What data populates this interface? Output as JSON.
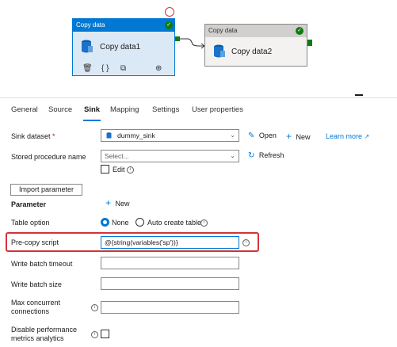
{
  "pipeline": {
    "activity1": {
      "header": "Copy data",
      "name": "Copy data1",
      "status": "succeeded",
      "selected": true
    },
    "activity2": {
      "header": "Copy data",
      "name": "Copy data2",
      "status": "succeeded",
      "selected": false
    },
    "tool_icons": [
      "delete-icon",
      "code-icon",
      "copy-icon",
      "add-output-icon"
    ]
  },
  "tabs": [
    {
      "label": "General"
    },
    {
      "label": "Source"
    },
    {
      "label": "Sink",
      "active": true
    },
    {
      "label": "Mapping"
    },
    {
      "label": "Settings"
    },
    {
      "label": "User properties"
    }
  ],
  "sink": {
    "dataset_label": "Sink dataset",
    "required_mark": "*",
    "dataset_value": "dummy_sink",
    "open_label": "Open",
    "new_label": "New",
    "learn_more_label": "Learn more",
    "stored_proc_label": "Stored procedure name",
    "stored_proc_placeholder": "Select...",
    "refresh_label": "Refresh",
    "edit_label": "Edit",
    "import_param_label": "Import parameter",
    "parameter_label": "Parameter",
    "param_new_label": "New",
    "table_option_label": "Table option",
    "table_option_none": "None",
    "table_option_auto": "Auto create table",
    "table_option_selected": "None",
    "precopy_label": "Pre-copy script",
    "precopy_value": "@{string(variables('sp'))}",
    "write_timeout_label": "Write batch timeout",
    "write_size_label": "Write batch size",
    "max_conn_label": "Max concurrent connections",
    "disable_perf_label": "Disable performance metrics analytics"
  },
  "colors": {
    "accent": "#0078d4",
    "success": "#107c10",
    "highlight": "#d13438"
  }
}
